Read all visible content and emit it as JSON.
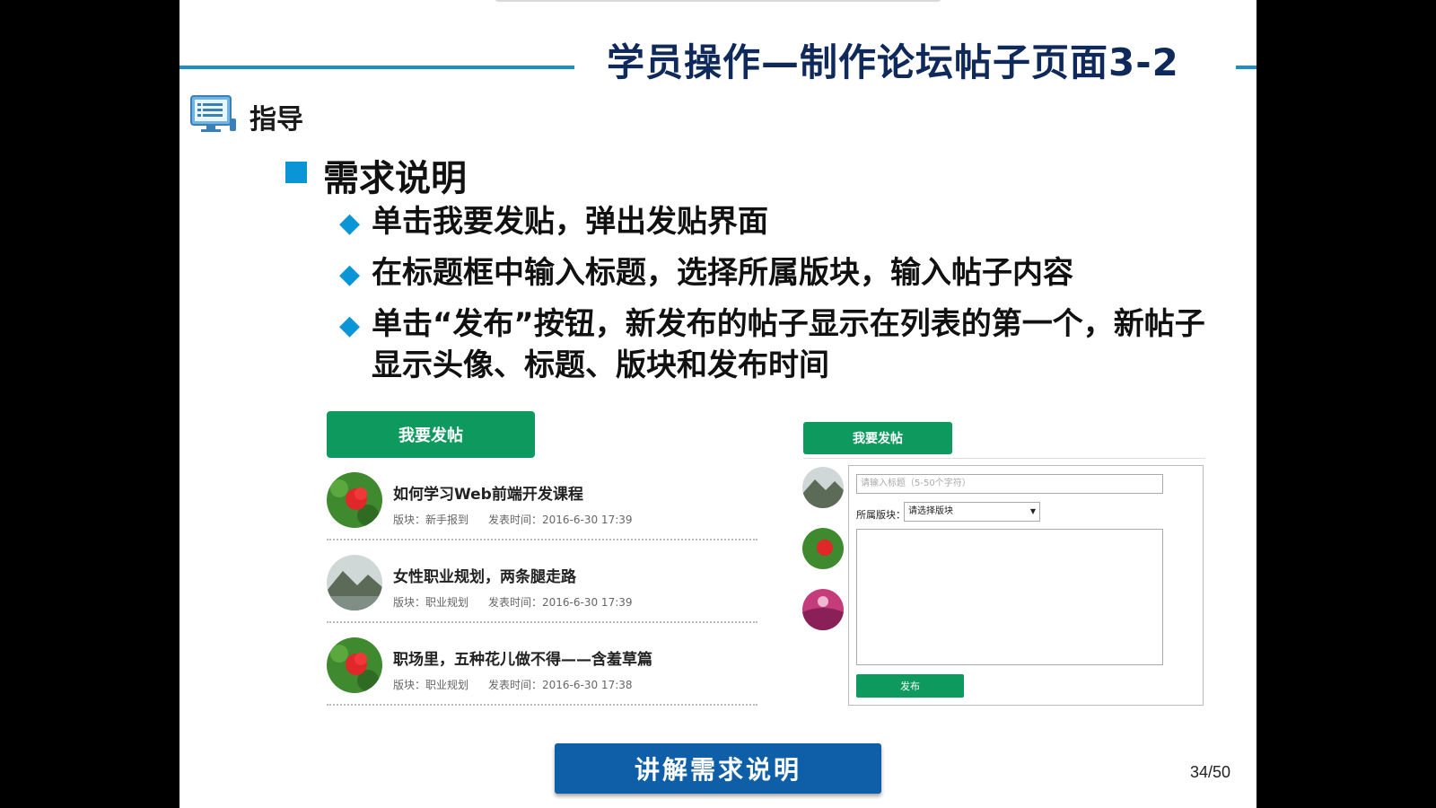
{
  "slide": {
    "title": "学员操作—制作论坛帖子页面3-2",
    "guide_label": "指导",
    "section_title": "需求说明",
    "requirements": [
      "单击我要发贴，弹出发贴界面",
      "在标题框中输入标题，选择所属版块，输入帖子内容",
      "单击“发布”按钮，新发布的帖子显示在列表的第一个，新帖子显示头像、标题、版块和发布时间"
    ],
    "page_number": "34/50",
    "explain_button": "讲解需求说明"
  },
  "forum_list": {
    "post_button": "我要发帖",
    "posts": [
      {
        "title": "如何学习Web前端开发课程",
        "section": "版块：新手报到",
        "time": "发表时间：2016-6-30 17:39",
        "avatar": "flower"
      },
      {
        "title": "女性职业规划，两条腿走路",
        "section": "版块：职业规划",
        "time": "发表时间：2016-6-30 17:39",
        "avatar": "landscape"
      },
      {
        "title": "职场里，五种花儿做不得——含羞草篇",
        "section": "版块：职业规划",
        "time": "发表时间：2016-6-30 17:38",
        "avatar": "flower"
      }
    ]
  },
  "post_dialog": {
    "post_button": "我要发帖",
    "title_placeholder": "请输入标题（5-50个字符）",
    "section_label": "所属版块：",
    "section_select": "请选择版块",
    "publish_button": "发布"
  },
  "colors": {
    "accent_blue": "#0a95d6",
    "title_navy": "#0f2a5a",
    "button_green": "#0e9a5e",
    "explain_blue": "#0f5fa8"
  }
}
